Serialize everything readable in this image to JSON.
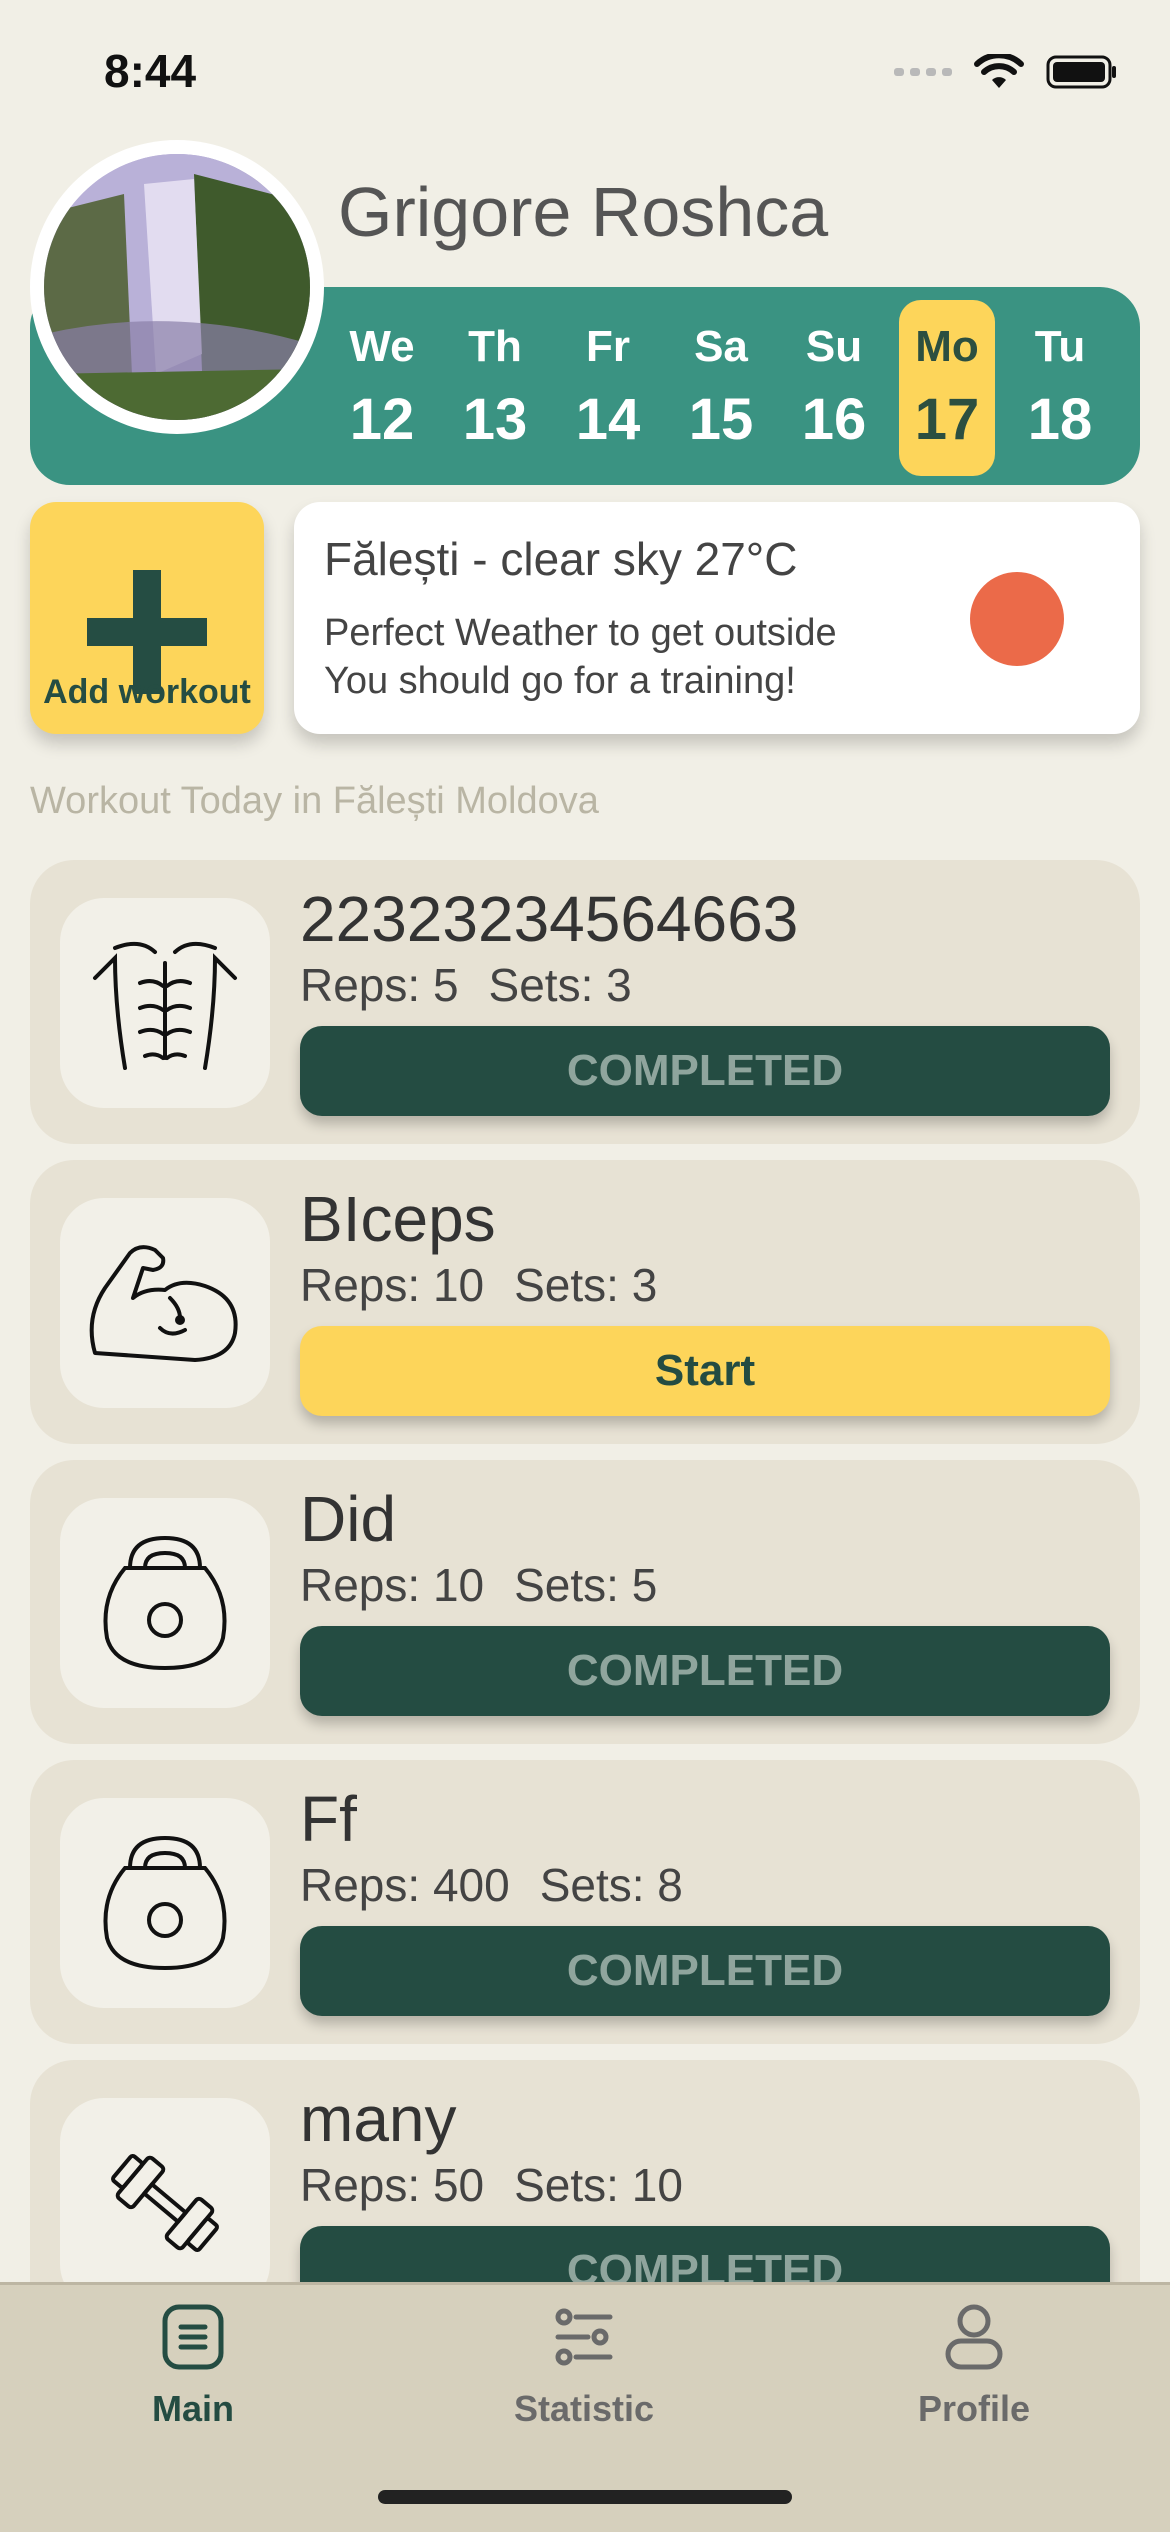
{
  "status_bar": {
    "time": "8:44"
  },
  "header": {
    "user_name": "Grigore Roshca",
    "days": [
      {
        "name": "We",
        "num": "12",
        "active": false
      },
      {
        "name": "Th",
        "num": "13",
        "active": false
      },
      {
        "name": "Fr",
        "num": "14",
        "active": false
      },
      {
        "name": "Sa",
        "num": "15",
        "active": false
      },
      {
        "name": "Su",
        "num": "16",
        "active": false
      },
      {
        "name": "Mo",
        "num": "17",
        "active": true
      },
      {
        "name": "Tu",
        "num": "18",
        "active": false
      }
    ]
  },
  "add_workout": {
    "label": "Add workout"
  },
  "weather": {
    "title": "Fălești - clear sky 27°C",
    "line1": "Perfect Weather to get outside",
    "line2": "You should go for a training!",
    "dot_color": "#eb6a49"
  },
  "section_title": "Workout Today in Fălești Moldova",
  "workouts": [
    {
      "name": "22323234564663",
      "reps": "Reps: 5",
      "sets": "Sets: 3",
      "button": "COMPLETED",
      "icon": "abs-icon"
    },
    {
      "name": "BIceps",
      "reps": "Reps: 10",
      "sets": "Sets: 3",
      "button": "Start",
      "icon": "biceps-icon"
    },
    {
      "name": "Did",
      "reps": "Reps: 10",
      "sets": "Sets: 5",
      "button": "COMPLETED",
      "icon": "kettlebell-icon"
    },
    {
      "name": "Ff",
      "reps": "Reps: 400",
      "sets": "Sets: 8",
      "button": "COMPLETED",
      "icon": "kettlebell-icon"
    },
    {
      "name": "many",
      "reps": "Reps: 50",
      "sets": "Sets: 10",
      "button": "COMPLETED",
      "icon": "dumbbell-icon"
    }
  ],
  "tabs": [
    {
      "label": "Main",
      "icon": "list-icon",
      "active": true
    },
    {
      "label": "Statistic",
      "icon": "sliders-icon",
      "active": false
    },
    {
      "label": "Profile",
      "icon": "person-icon",
      "active": false
    }
  ],
  "colors": {
    "background": "#f1efe6",
    "accent_green": "#3a9382",
    "dark_green": "#244c42",
    "accent_yellow": "#fdd55a",
    "card": "#e7e2d4"
  }
}
